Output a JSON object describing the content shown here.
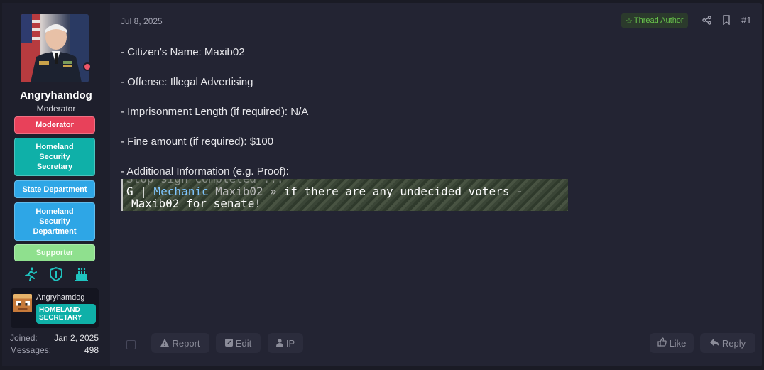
{
  "post": {
    "date": "Jul 8, 2025",
    "thread_author_label": "Thread Author",
    "post_number": "#1",
    "body_lines": [
      "- Citizen's Name: Maxib02",
      "- Offense: Illegal Advertising",
      "- Imprisonment Length (if required): N/A",
      "- Fine amount (if required): $100",
      "- Additional Information (e.g. Proof):"
    ],
    "proof_image": {
      "ghost_text": "Stop sign completed ...",
      "prefix": "G | ",
      "rank": "Mechanic",
      "name": " Maxib02 » ",
      "message": "if there are any undecided voters -",
      "message_cont": "Maxib02 for senate!"
    }
  },
  "user": {
    "username": "Angryhamdog",
    "title": "Moderator",
    "badges": [
      "Moderator",
      "Homeland Security Secretary",
      "State Department",
      "Homeland Security Department",
      "Supporter"
    ],
    "trophy_icons": [
      "runner-icon",
      "shield-icon",
      "cake-icon"
    ],
    "mini_card": {
      "name": "Angryhamdog",
      "badge": "HOMELAND SECRETARY"
    },
    "stats": [
      {
        "label": "Joined:",
        "value": "Jan 2, 2025"
      },
      {
        "label": "Messages:",
        "value": "498"
      }
    ]
  },
  "actions": {
    "report": "Report",
    "edit": "Edit",
    "ip": "IP",
    "like": "Like",
    "reply": "Reply"
  },
  "colors": {
    "background": "#1a1b25",
    "panel": "#232433",
    "moderator": "#e8415a",
    "teal": "#0fb0a8",
    "blue": "#2ea6e6",
    "supporter": "#8fe08e",
    "thread_author": "#68c24b"
  }
}
